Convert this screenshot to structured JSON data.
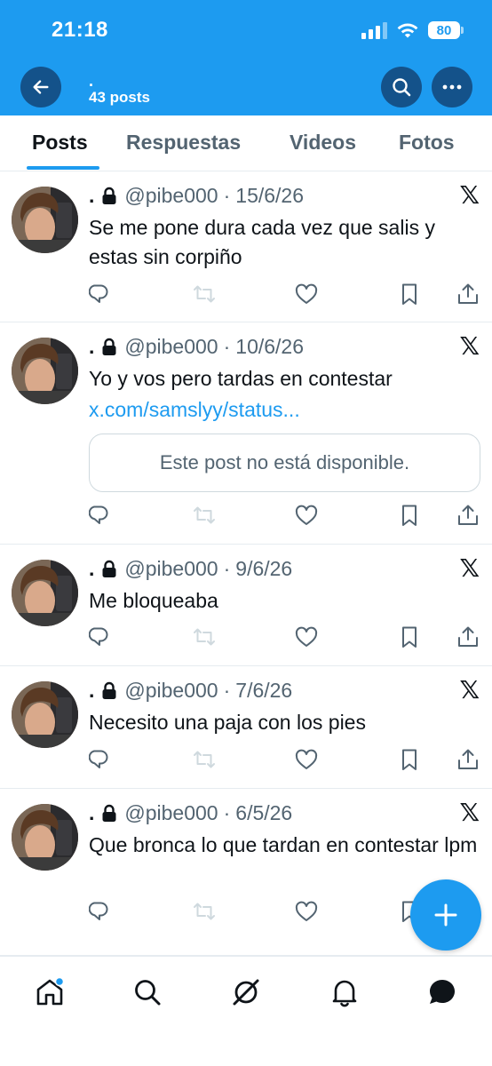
{
  "status_bar": {
    "time": "21:18",
    "battery": "80"
  },
  "header": {
    "name": ".",
    "post_count": "43 posts"
  },
  "tabs": [
    {
      "label": "Posts",
      "active": true
    },
    {
      "label": "Respuestas",
      "active": false
    },
    {
      "label": "Videos",
      "active": false
    },
    {
      "label": "Fotos",
      "active": false
    }
  ],
  "posts": [
    {
      "name": ".",
      "handle": "@pibe000",
      "date": "15/6/26",
      "text": "Se me pone dura cada vez que salis y estas sin corpiño"
    },
    {
      "name": ".",
      "handle": "@pibe000",
      "date": "10/6/26",
      "text": "Yo y vos pero tardas en contestar",
      "link": "x.com/samslyy/status...",
      "quote_unavailable": "Este post no está disponible."
    },
    {
      "name": ".",
      "handle": "@pibe000",
      "date": "9/6/26",
      "text": "Me bloqueaba"
    },
    {
      "name": ".",
      "handle": "@pibe000",
      "date": "7/6/26",
      "text": "Necesito una paja con los pies"
    },
    {
      "name": ".",
      "handle": "@pibe000",
      "date": "6/5/26",
      "text": "Que bronca lo que tardan en contestar lpm"
    }
  ],
  "separator": "·",
  "x_logo": "𝕏",
  "colors": {
    "brand": "#1d9bf0",
    "text": "#0f1419",
    "muted": "#536471",
    "header_button": "#14528a"
  },
  "icons": [
    "back-arrow-icon",
    "search-icon",
    "more-icon",
    "lock-icon",
    "x-logo-icon",
    "reply-icon",
    "repost-icon",
    "like-icon",
    "bookmark-icon",
    "share-icon",
    "compose-icon",
    "home-icon",
    "grok-icon",
    "bell-icon",
    "messages-icon"
  ]
}
